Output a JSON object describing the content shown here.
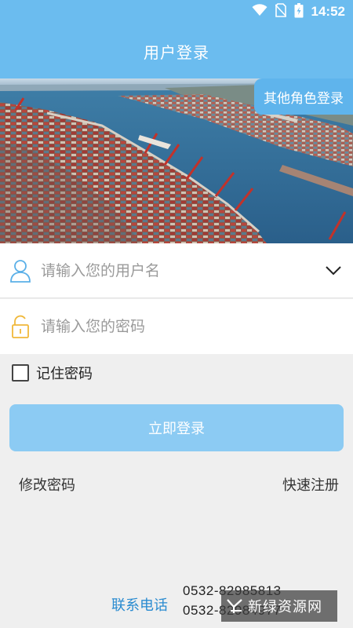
{
  "status_bar": {
    "time": "14:52",
    "icons": [
      "wifi-icon",
      "no-sim-icon",
      "battery-charging-icon"
    ]
  },
  "header": {
    "title": "用户登录"
  },
  "banner": {
    "role_button_label": "其他角色登录"
  },
  "form": {
    "username_placeholder": "请输入您的用户名",
    "password_placeholder": "请输入您的密码",
    "remember_label": "记住密码",
    "remember_checked": false,
    "login_button_label": "立即登录"
  },
  "links": {
    "change_password": "修改密码",
    "quick_register": "快速注册"
  },
  "contact": {
    "label": "联系电话",
    "phones": [
      "0532-82985813",
      "0532-82984977"
    ]
  },
  "watermark": {
    "text": "新绿资源网"
  },
  "colors": {
    "primary": "#6bbcef",
    "button": "#8ccbf3",
    "contact_label": "#2a8bd0",
    "lock_icon": "#f0b83a"
  }
}
